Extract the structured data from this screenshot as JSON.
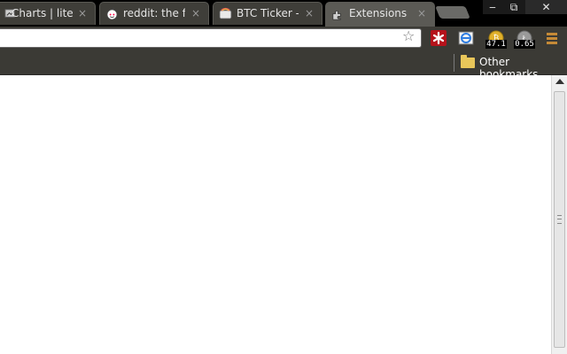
{
  "tabs": [
    {
      "title": "Charts | litecoin",
      "close": "×",
      "icon": "chart-icon"
    },
    {
      "title": "reddit: the front page",
      "close": "×",
      "icon": "reddit-icon"
    },
    {
      "title": "BTC Ticker - Chrome Web Store",
      "close": "×",
      "icon": "web-store-icon"
    },
    {
      "title": "Extensions",
      "close": "×",
      "icon": "puzzle-icon"
    }
  ],
  "window": {
    "minimize": "‒",
    "restore": "⧉",
    "close": "✕"
  },
  "toolbar": {
    "star": "☆",
    "extensions": [
      {
        "name": "lastpass-icon"
      },
      {
        "name": "ie-tab-icon"
      },
      {
        "name": "btc-ticker-icon",
        "value": "47.1"
      },
      {
        "name": "ltc-ticker-icon",
        "value": "0.65"
      },
      {
        "name": "chrome-menu-icon"
      }
    ]
  },
  "bookmarks": {
    "other": "Other bookmarks"
  },
  "colors": {
    "accent": "#2f7de1",
    "tabActive": "#5b5a55"
  }
}
